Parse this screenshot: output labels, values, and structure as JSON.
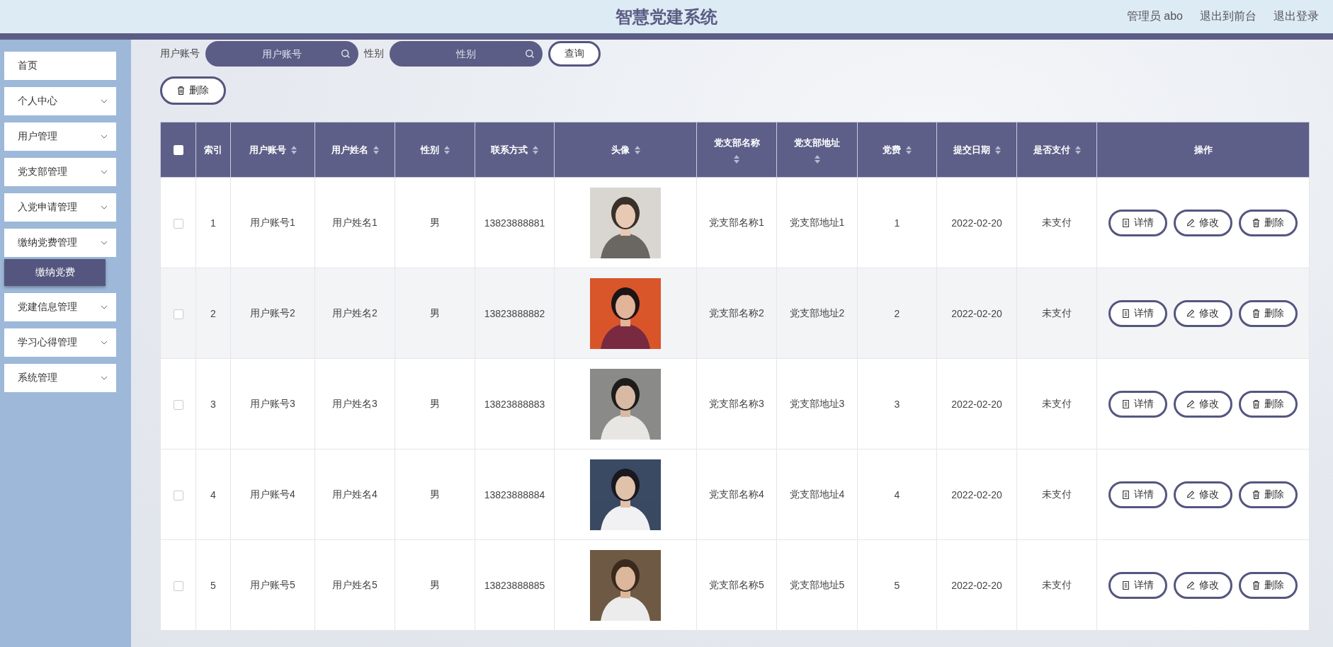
{
  "header": {
    "title": "智慧党建系统",
    "links": [
      "管理员 abo",
      "退出到前台",
      "退出登录"
    ]
  },
  "sidebar": {
    "items": [
      {
        "label": "首页",
        "expandable": false
      },
      {
        "label": "个人中心",
        "expandable": true
      },
      {
        "label": "用户管理",
        "expandable": true
      },
      {
        "label": "党支部管理",
        "expandable": true
      },
      {
        "label": "入党申请管理",
        "expandable": true
      },
      {
        "label": "缴纳党费管理",
        "expandable": true,
        "children": [
          {
            "label": "缴纳党费",
            "selected": true
          }
        ]
      },
      {
        "label": "党建信息管理",
        "expandable": true
      },
      {
        "label": "学习心得管理",
        "expandable": true
      },
      {
        "label": "系统管理",
        "expandable": true
      }
    ]
  },
  "search": {
    "fields": [
      {
        "label": "用户账号",
        "placeholder": "用户账号"
      },
      {
        "label": "性别",
        "placeholder": "性别"
      }
    ],
    "button": "查询"
  },
  "toolbar": {
    "delete_button": "删除"
  },
  "table": {
    "select_all": {
      "checked": false
    },
    "columns": [
      {
        "label": "索引",
        "sortable": false
      },
      {
        "label": "用户账号",
        "sortable": true
      },
      {
        "label": "用户姓名",
        "sortable": true
      },
      {
        "label": "性别",
        "sortable": true
      },
      {
        "label": "联系方式",
        "sortable": true
      },
      {
        "label": "头像",
        "sortable": true
      },
      {
        "label": "党支部名称",
        "sortable": true
      },
      {
        "label": "党支部地址",
        "sortable": true
      },
      {
        "label": "党费",
        "sortable": true
      },
      {
        "label": "提交日期",
        "sortable": true
      },
      {
        "label": "是否支付",
        "sortable": true
      },
      {
        "label": "操作",
        "sortable": false
      }
    ],
    "rows": [
      {
        "checked": false,
        "highlighted": false,
        "cells": [
          "1",
          "用户账号1",
          "用户姓名1",
          "男",
          "13823888881"
        ],
        "cells2": [
          "党支部名称1",
          "党支部地址1",
          "1",
          "2022-02-20",
          "未支付"
        ],
        "actions": [
          {
            "kind": "detail",
            "label": "详情"
          },
          {
            "kind": "edit",
            "label": "修改"
          },
          {
            "kind": "delete",
            "label": "删除"
          }
        ]
      },
      {
        "checked": false,
        "highlighted": true,
        "cells": [
          "2",
          "用户账号2",
          "用户姓名2",
          "男",
          "13823888882"
        ],
        "cells2": [
          "党支部名称2",
          "党支部地址2",
          "2",
          "2022-02-20",
          "未支付"
        ],
        "actions": [
          {
            "kind": "detail",
            "label": "详情"
          },
          {
            "kind": "edit",
            "label": "修改"
          },
          {
            "kind": "delete",
            "label": "删除"
          }
        ]
      },
      {
        "checked": false,
        "highlighted": false,
        "cells": [
          "3",
          "用户账号3",
          "用户姓名3",
          "男",
          "13823888883"
        ],
        "cells2": [
          "党支部名称3",
          "党支部地址3",
          "3",
          "2022-02-20",
          "未支付"
        ],
        "actions": [
          {
            "kind": "detail",
            "label": "详情"
          },
          {
            "kind": "edit",
            "label": "修改"
          },
          {
            "kind": "delete",
            "label": "删除"
          }
        ]
      },
      {
        "checked": false,
        "highlighted": false,
        "cells": [
          "4",
          "用户账号4",
          "用户姓名4",
          "男",
          "13823888884"
        ],
        "cells2": [
          "党支部名称4",
          "党支部地址4",
          "4",
          "2022-02-20",
          "未支付"
        ],
        "actions": [
          {
            "kind": "detail",
            "label": "详情"
          },
          {
            "kind": "edit",
            "label": "修改"
          },
          {
            "kind": "delete",
            "label": "删除"
          }
        ]
      },
      {
        "checked": false,
        "highlighted": false,
        "cells": [
          "5",
          "用户账号5",
          "用户姓名5",
          "男",
          "13823888885"
        ],
        "cells2": [
          "党支部名称5",
          "党支部地址5",
          "5",
          "2022-02-20",
          "未支付"
        ],
        "actions": [
          {
            "kind": "detail",
            "label": "详情"
          },
          {
            "kind": "edit",
            "label": "修改"
          },
          {
            "kind": "delete",
            "label": "删除"
          }
        ]
      }
    ]
  }
}
